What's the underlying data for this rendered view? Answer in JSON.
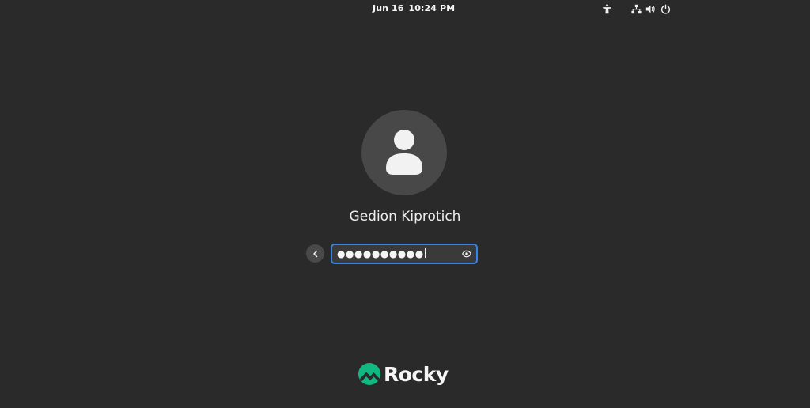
{
  "topbar": {
    "date": "Jun 16",
    "time": "10:24 PM",
    "icons": [
      "accessibility-icon",
      "network-icon",
      "volume-icon",
      "power-icon"
    ]
  },
  "login": {
    "avatar_icon": "user-avatar-icon",
    "username": "Gedion Kiprotich",
    "password_mask": "●●●●●●●●●●",
    "back_icon": "chevron-left-icon",
    "reveal_icon": "eye-icon"
  },
  "branding": {
    "logo_text": "Rocky",
    "logo_color": "#10b981"
  },
  "colors": {
    "background": "#2a2a2a",
    "accent": "#3584e4",
    "avatar_bg": "#484848"
  }
}
